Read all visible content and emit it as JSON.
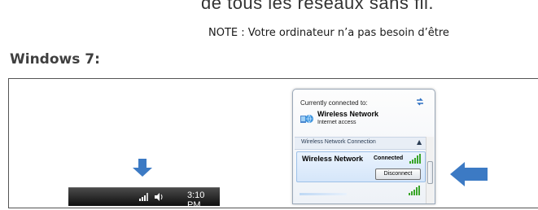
{
  "document": {
    "line1": "de tous les réseaux sans fil.",
    "note": "NOTE : Votre ordinateur n’a pas besoin d’être",
    "section_heading": "Windows 7:"
  },
  "taskbar": {
    "time": "3:10 PM",
    "icons": [
      "signal-icon",
      "volume-icon"
    ]
  },
  "network_panel": {
    "header": "Currently connected to:",
    "current_network": {
      "name": "Wireless Network",
      "status": "Internet access"
    },
    "section_label": "Wireless Network Connection",
    "selected_network": {
      "name": "Wireless Network",
      "status": "Connected",
      "button_label": "Disconnect"
    },
    "icons": [
      "refresh-icon",
      "globe-network-icon",
      "signal-strength-icon"
    ]
  },
  "colors": {
    "arrow": "#3c7ac4",
    "taskbar": "#1a1a1a",
    "panel_highlight": "#d5e6fa",
    "signal_green": "#3aa52a"
  }
}
